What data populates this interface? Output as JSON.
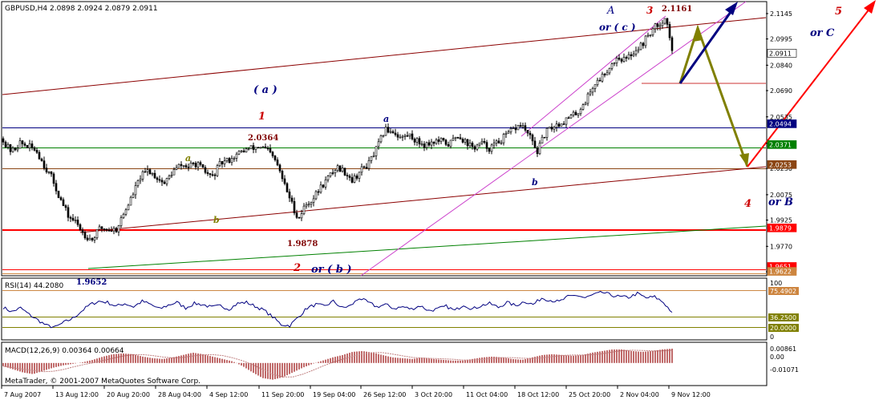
{
  "chart_data": {
    "type": "candlestick",
    "instrument_header": "GBPUSD,H4  2.0898 2.0924 2.0879 2.0911",
    "footer": "MetaTrader, © 2001-2007 MetaQuotes Software Corp.",
    "price_axis": {
      "ylim": [
        1.9601,
        2.1211
      ],
      "ticks": [
        "2.1145",
        "2.0995",
        "2.0840",
        "2.0690",
        "2.0535",
        "2.0380",
        "2.0230",
        "2.0075",
        "1.9925",
        "1.9770",
        "1.9620"
      ]
    },
    "date_ticks": [
      "7 Aug 2007",
      "13 Aug 12:00",
      "20 Aug 20:00",
      "28 Aug 04:00",
      "4 Sep 12:00",
      "11 Sep 20:00",
      "19 Sep 04:00",
      "26 Sep 12:00",
      "3 Oct 20:00",
      "11 Oct 04:00",
      "18 Oct 12:00",
      "25 Oct 20:00",
      "2 Nov 04:00",
      "9 Nov 12:00"
    ],
    "price_path": [
      [
        1,
        2.046
      ],
      [
        6,
        2.037
      ],
      [
        15,
        2.033
      ],
      [
        25,
        2.038
      ],
      [
        35,
        2.036
      ],
      [
        45,
        2.034
      ],
      [
        55,
        2.025
      ],
      [
        65,
        2.017
      ],
      [
        75,
        2.005
      ],
      [
        85,
        1.995
      ],
      [
        95,
        1.991
      ],
      [
        105,
        1.984
      ],
      [
        115,
        1.981
      ],
      [
        125,
        1.988
      ],
      [
        135,
        1.987
      ],
      [
        145,
        1.987
      ],
      [
        155,
        1.997
      ],
      [
        165,
        2.007
      ],
      [
        175,
        2.018
      ],
      [
        185,
        2.022
      ],
      [
        195,
        2.018
      ],
      [
        205,
        2.014
      ],
      [
        215,
        2.021
      ],
      [
        225,
        2.025
      ],
      [
        235,
        2.024
      ],
      [
        245,
        2.026
      ],
      [
        255,
        2.021
      ],
      [
        265,
        2.018
      ],
      [
        275,
        2.026
      ],
      [
        285,
        2.028
      ],
      [
        295,
        2.031
      ],
      [
        305,
        2.034
      ],
      [
        315,
        2.035
      ],
      [
        325,
        2.036
      ],
      [
        335,
        2.033
      ],
      [
        345,
        2.026
      ],
      [
        355,
        2.013
      ],
      [
        365,
        2.001
      ],
      [
        372,
        1.993
      ],
      [
        380,
        2.001
      ],
      [
        390,
        2.005
      ],
      [
        400,
        2.012
      ],
      [
        410,
        2.018
      ],
      [
        420,
        2.024
      ],
      [
        430,
        2.021
      ],
      [
        440,
        2.016
      ],
      [
        450,
        2.022
      ],
      [
        460,
        2.026
      ],
      [
        470,
        2.035
      ],
      [
        480,
        2.046
      ],
      [
        490,
        2.045
      ],
      [
        500,
        2.041
      ],
      [
        510,
        2.043
      ],
      [
        520,
        2.039
      ],
      [
        530,
        2.037
      ],
      [
        540,
        2.039
      ],
      [
        550,
        2.039
      ],
      [
        560,
        2.037
      ],
      [
        570,
        2.043
      ],
      [
        580,
        2.039
      ],
      [
        590,
        2.035
      ],
      [
        600,
        2.038
      ],
      [
        610,
        2.035
      ],
      [
        620,
        2.038
      ],
      [
        630,
        2.042
      ],
      [
        640,
        2.046
      ],
      [
        650,
        2.049
      ],
      [
        660,
        2.042
      ],
      [
        670,
        2.033
      ],
      [
        680,
        2.044
      ],
      [
        690,
        2.048
      ],
      [
        700,
        2.05
      ],
      [
        710,
        2.053
      ],
      [
        720,
        2.056
      ],
      [
        730,
        2.063
      ],
      [
        740,
        2.072
      ],
      [
        750,
        2.077
      ],
      [
        760,
        2.083
      ],
      [
        770,
        2.089
      ],
      [
        780,
        2.087
      ],
      [
        790,
        2.092
      ],
      [
        800,
        2.096
      ],
      [
        810,
        2.103
      ],
      [
        820,
        2.108
      ],
      [
        830,
        2.112
      ],
      [
        835,
        2.101
      ],
      [
        838,
        2.091
      ]
    ],
    "price_labels": [
      {
        "text": "2.0911",
        "value": 2.0911,
        "bg": "#ffffff",
        "fg": "#000000"
      },
      {
        "text": "2.0494",
        "value": 2.0494,
        "bg": "#000080",
        "fg": "#ffffff"
      },
      {
        "text": "2.0371",
        "value": 2.0371,
        "bg": "#008000",
        "fg": "#ffffff"
      },
      {
        "text": "2.0253",
        "value": 2.0253,
        "bg": "#8b4513",
        "fg": "#ffffff"
      },
      {
        "text": "1.9879",
        "value": 1.9879,
        "bg": "#ff0000",
        "fg": "#ffffff"
      },
      {
        "text": "1.9651",
        "value": 1.9651,
        "bg": "#ff0000",
        "fg": "#ffffff"
      },
      {
        "text": "1.9622",
        "value": 1.9622,
        "bg": "#cd853f",
        "fg": "#ffffff"
      }
    ],
    "value_labels": [
      "2.1161",
      "2.0364",
      "1.9878",
      "1.9652"
    ],
    "wave_labels": [
      {
        "text": "A",
        "color": "#000080"
      },
      {
        "text": "or ( c )",
        "color": "#000080"
      },
      {
        "text": "3",
        "color": "#cc0000"
      },
      {
        "text": "5",
        "color": "#cc0000"
      },
      {
        "text": "or  C",
        "color": "#000080"
      },
      {
        "text": "( a )",
        "color": "#000080"
      },
      {
        "text": "1",
        "color": "#cc0000"
      },
      {
        "text": "a",
        "color": "#000080"
      },
      {
        "text": "a",
        "color": "#808000"
      },
      {
        "text": "b",
        "color": "#000080"
      },
      {
        "text": "b",
        "color": "#808000"
      },
      {
        "text": "4",
        "color": "#cc0000"
      },
      {
        "text": "or  B",
        "color": "#000080"
      },
      {
        "text": "2",
        "color": "#cc0000"
      },
      {
        "text": "or ( b )",
        "color": "#000080"
      }
    ],
    "rsi": {
      "label": "RSI(14) 44.2080",
      "ylim": [
        0,
        100
      ],
      "axis_labels": [
        "100",
        "75.4902",
        "36.2500",
        "20.0000",
        "0"
      ],
      "values": [
        53,
        45,
        52,
        40,
        30,
        20,
        17,
        26,
        33,
        46,
        58,
        64,
        62,
        55,
        60,
        54,
        64,
        58,
        50,
        57,
        62,
        52,
        60,
        58,
        53,
        56,
        50,
        60,
        62,
        55,
        48,
        36,
        22,
        20,
        36,
        52,
        58,
        55,
        64,
        52,
        56,
        70,
        62,
        54,
        58,
        51,
        54,
        50,
        56,
        47,
        50,
        55,
        47,
        58,
        50,
        56,
        60,
        53,
        62,
        56,
        64,
        58,
        70,
        66,
        63,
        72,
        75,
        70,
        76,
        80,
        75,
        72,
        71,
        78,
        70,
        72,
        62,
        44
      ]
    },
    "macd": {
      "label": "MACD(12,26,9) 0.00364 0.00664",
      "ylim": [
        -0.0132,
        0.0115
      ],
      "axis_labels": [
        "0.00861",
        "0.00",
        "-0.01071"
      ],
      "values": [
        -0.002,
        -0.004,
        -0.006,
        -0.007,
        -0.005,
        -0.003,
        -0.0015,
        -0.0005,
        0.0005,
        0.002,
        0.004,
        0.0055,
        0.006,
        0.0055,
        0.004,
        0.003,
        0.0025,
        0.0035,
        0.005,
        0.0065,
        0.0055,
        0.004,
        0.0025,
        0.001,
        -0.002,
        -0.006,
        -0.0095,
        -0.0105,
        -0.009,
        -0.006,
        -0.003,
        -0.0005,
        0.0015,
        0.0035,
        0.005,
        0.007,
        0.0075,
        0.0065,
        0.005,
        0.0035,
        0.003,
        0.0025,
        0.0035,
        0.0025,
        0.002,
        0.0015,
        0.0015,
        0.0025,
        0.0035,
        0.004,
        0.0035,
        0.0025,
        0.002,
        0.0035,
        0.005,
        0.0055,
        0.005,
        0.0045,
        0.005,
        0.0065,
        0.0075,
        0.0085,
        0.0085,
        0.0075,
        0.007,
        0.0075,
        0.0085,
        0.009
      ]
    }
  }
}
